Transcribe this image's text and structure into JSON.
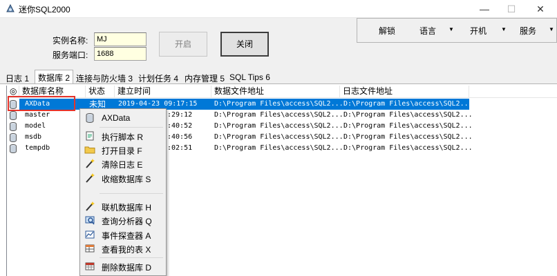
{
  "window": {
    "title": "迷你SQL2000",
    "minimize": "—",
    "maximize": "☐",
    "close": "✕"
  },
  "form": {
    "instance_label": "实例名称:",
    "instance_value": "MJ",
    "port_label": "服务端口:",
    "port_value": "1688",
    "start_button": "开启",
    "close_button": "关闭"
  },
  "toolbar": {
    "unlock": "解锁",
    "language": "语言",
    "power": "开机",
    "service": "服务"
  },
  "tabs": [
    {
      "label": "日志 1"
    },
    {
      "label": "数据库 2"
    },
    {
      "label": "连接与防火墙 3"
    },
    {
      "label": "计划任务 4"
    },
    {
      "label": "内存管理 5"
    },
    {
      "label": "SQL Tips 6"
    }
  ],
  "list": {
    "headers": {
      "icon": "◎",
      "name": "数据库名称",
      "status": "状态",
      "created": "建立时间",
      "data_file": "数据文件地址",
      "log_file": "日志文件地址"
    },
    "rows": [
      {
        "name": "AXData",
        "status": "未知",
        "created": "2019-04-23 09:17:15",
        "data_file": "D:\\Program Files\\access\\SQL2...",
        "log_file": "D:\\Program Files\\access\\SQL2..."
      },
      {
        "name": "master",
        "status": "",
        "created": ":29:12",
        "data_file": "D:\\Program Files\\access\\SQL2...",
        "log_file": "D:\\Program Files\\access\\SQL2..."
      },
      {
        "name": "model",
        "status": "",
        "created": ":40:52",
        "data_file": "D:\\Program Files\\access\\SQL2...",
        "log_file": "D:\\Program Files\\access\\SQL2..."
      },
      {
        "name": "msdb",
        "status": "",
        "created": ":40:56",
        "data_file": "D:\\Program Files\\access\\SQL2...",
        "log_file": "D:\\Program Files\\access\\SQL2..."
      },
      {
        "name": "tempdb",
        "status": "",
        "created": ":02:51",
        "data_file": "D:\\Program Files\\access\\SQL2...",
        "log_file": "D:\\Program Files\\access\\SQL2..."
      }
    ]
  },
  "context_menu": {
    "items": [
      {
        "label": "AXData",
        "icon": "database-icon"
      },
      {
        "label": "执行脚本 R",
        "icon": "script-icon"
      },
      {
        "label": "打开目录 F",
        "icon": "folder-icon"
      },
      {
        "label": "清除日志 E",
        "icon": "wand-icon"
      },
      {
        "label": "收缩数据库 S",
        "icon": "wand-icon"
      },
      {
        "label": "联机数据库 H",
        "icon": "wand-icon"
      },
      {
        "label": "查询分析器 Q",
        "icon": "query-analyzer-icon"
      },
      {
        "label": "事件探查器 A",
        "icon": "profiler-icon"
      },
      {
        "label": "查看我的表 X",
        "icon": "table-icon"
      },
      {
        "label": "删除数据库 D",
        "icon": "delete-db-icon"
      }
    ]
  },
  "colors": {
    "selection": "#0078d7",
    "input_bg": "#ffffe1",
    "highlight_box": "#e5342b"
  }
}
